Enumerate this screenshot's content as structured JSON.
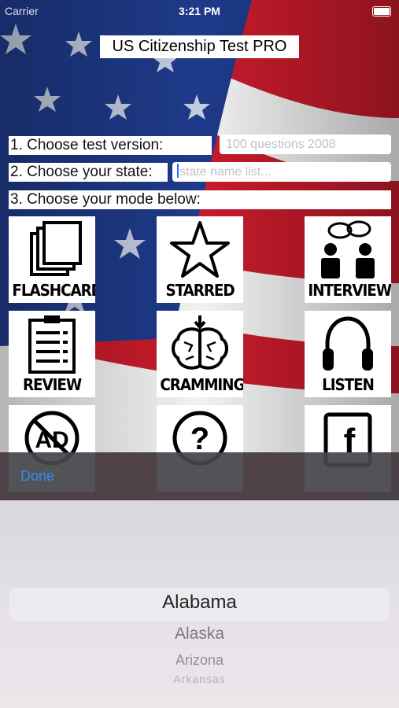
{
  "status": {
    "carrier": "Carrier",
    "time": "3:21 PM"
  },
  "app_title": "US Citizenship Test PRO",
  "steps": {
    "version_label": "1. Choose test version:",
    "version_placeholder": "100 questions 2008",
    "state_label": "2. Choose your state:",
    "state_placeholder": "state name list...",
    "mode_label": "3. Choose your mode below:"
  },
  "modes": [
    {
      "label": "FLASHCARDS",
      "icon": "cards-icon"
    },
    {
      "label": "STARRED",
      "icon": "star-icon"
    },
    {
      "label": "INTERVIEW",
      "icon": "people-chat-icon"
    },
    {
      "label": "REVIEW",
      "icon": "clipboard-list-icon"
    },
    {
      "label": "CRAMMING",
      "icon": "brain-icon"
    },
    {
      "label": "LISTEN",
      "icon": "headphones-icon"
    },
    {
      "label": "",
      "icon": "no-ads-icon"
    },
    {
      "label": "",
      "icon": "help-icon"
    },
    {
      "label": "",
      "icon": "facebook-icon"
    }
  ],
  "picker": {
    "done_label": "Done",
    "options": [
      "Alabama",
      "Alaska",
      "Arizona",
      "Arkansas"
    ],
    "selected": "Alabama"
  },
  "colors": {
    "accent": "#2d8ff0",
    "flag_blue": "#1e3a8a",
    "flag_red": "#c8102e"
  }
}
